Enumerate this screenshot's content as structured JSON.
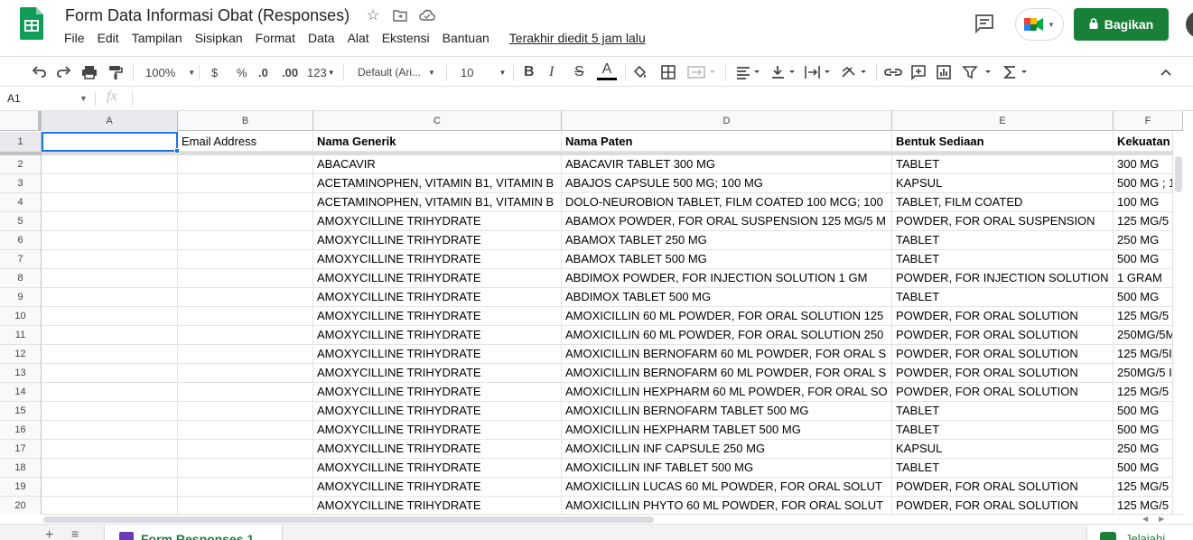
{
  "header": {
    "title": "Form Data Informasi Obat (Responses)",
    "menu": [
      "File",
      "Edit",
      "Tampilan",
      "Sisipkan",
      "Format",
      "Data",
      "Alat",
      "Ekstensi",
      "Bantuan"
    ],
    "last_edit": "Terakhir diedit 5 jam lalu",
    "share_label": "Bagikan"
  },
  "toolbar": {
    "zoom": "100%",
    "currency": "$",
    "percent": "%",
    "decrease_decimal": ".0",
    "increase_decimal": ".00",
    "more_formats": "123",
    "font": "Default (Ari...",
    "font_size": "10",
    "bold": "B",
    "italic": "I",
    "strike": "S",
    "text_color": "A"
  },
  "formula_bar": {
    "name_box": "A1",
    "fx": "fx"
  },
  "grid": {
    "columns": [
      "A",
      "B",
      "C",
      "D",
      "E",
      "F"
    ],
    "headers": [
      "",
      "Email Address",
      "Nama Generik",
      "Nama Paten",
      "Bentuk Sediaan",
      "Kekuatan"
    ],
    "row_numbers": [
      "1",
      "2",
      "3",
      "4",
      "5",
      "6",
      "7",
      "8",
      "9",
      "10",
      "11",
      "12",
      "13",
      "14",
      "15",
      "16",
      "17",
      "18",
      "19",
      "20"
    ],
    "rows": [
      [
        "",
        "",
        "ABACAVIR",
        "ABACAVIR TABLET 300 MG",
        "TABLET",
        "300 MG"
      ],
      [
        "",
        "",
        "ACETAMINOPHEN, VITAMIN B1, VITAMIN B",
        "ABAJOS CAPSULE 500 MG; 100 MG",
        "KAPSUL",
        "500 MG ; 1"
      ],
      [
        "",
        "",
        "ACETAMINOPHEN, VITAMIN B1, VITAMIN B",
        "DOLO-NEUROBION TABLET, FILM COATED 100 MCG; 100",
        "TABLET, FILM COATED",
        "100 MG"
      ],
      [
        "",
        "",
        "AMOXYCILLINE TRIHYDRATE",
        "ABAMOX POWDER, FOR ORAL SUSPENSION 125 MG/5 M",
        "POWDER, FOR ORAL SUSPENSION",
        "125 MG/5"
      ],
      [
        "",
        "",
        "AMOXYCILLINE TRIHYDRATE",
        "ABAMOX TABLET 250 MG",
        "TABLET",
        "250 MG"
      ],
      [
        "",
        "",
        "AMOXYCILLINE TRIHYDRATE",
        "ABAMOX TABLET 500 MG",
        "TABLET",
        "500 MG"
      ],
      [
        "",
        "",
        "AMOXYCILLINE TRIHYDRATE",
        "ABDIMOX POWDER, FOR INJECTION SOLUTION 1 GM",
        "POWDER, FOR INJECTION SOLUTION",
        "1 GRAM"
      ],
      [
        "",
        "",
        "AMOXYCILLINE TRIHYDRATE",
        "ABDIMOX TABLET 500 MG",
        "TABLET",
        "500 MG"
      ],
      [
        "",
        "",
        "AMOXYCILLINE TRIHYDRATE",
        "AMOXICILLIN 60 ML POWDER, FOR ORAL SOLUTION 125",
        "POWDER, FOR ORAL SOLUTION",
        "125 MG/5"
      ],
      [
        "",
        "",
        "AMOXYCILLINE TRIHYDRATE",
        "AMOXICILLIN 60 ML POWDER, FOR ORAL SOLUTION 250",
        "POWDER, FOR ORAL SOLUTION",
        "250MG/5M"
      ],
      [
        "",
        "",
        "AMOXYCILLINE TRIHYDRATE",
        "AMOXICILLIN BERNOFARM 60 ML POWDER, FOR ORAL S",
        "POWDER, FOR ORAL SOLUTION",
        "125 MG/5I"
      ],
      [
        "",
        "",
        "AMOXYCILLINE TRIHYDRATE",
        "AMOXICILLIN BERNOFARM 60 ML POWDER, FOR ORAL S",
        "POWDER, FOR ORAL SOLUTION",
        "250MG/5 I"
      ],
      [
        "",
        "",
        "AMOXYCILLINE TRIHYDRATE",
        "AMOXICILLIN HEXPHARM 60 ML POWDER, FOR ORAL SO",
        "POWDER, FOR ORAL SOLUTION",
        "125 MG/5"
      ],
      [
        "",
        "",
        "AMOXYCILLINE TRIHYDRATE",
        "AMOXICILLIN BERNOFARM TABLET 500 MG",
        "TABLET",
        "500 MG"
      ],
      [
        "",
        "",
        "AMOXYCILLINE TRIHYDRATE",
        "AMOXICILLIN  HEXPHARM TABLET 500 MG",
        "TABLET",
        "500 MG"
      ],
      [
        "",
        "",
        "AMOXYCILLINE TRIHYDRATE",
        "AMOXICILLIN INF CAPSULE 250 MG",
        "KAPSUL",
        "250 MG"
      ],
      [
        "",
        "",
        "AMOXYCILLINE TRIHYDRATE",
        "AMOXICILLIN  INF TABLET 500 MG",
        "TABLET",
        "500 MG"
      ],
      [
        "",
        "",
        "AMOXYCILLINE TRIHYDRATE",
        "AMOXICILLIN LUCAS 60 ML POWDER, FOR ORAL SOLUT",
        "POWDER, FOR  ORAL SOLUTION",
        "125 MG/5"
      ],
      [
        "",
        "",
        "AMOXYCILLINE TRIHYDRATE",
        "AMOXICILLIN PHYTO 60 ML POWDER, FOR ORAL SOLUT",
        "POWDER, FOR ORAL SOLUTION",
        "125 MG/5"
      ]
    ]
  },
  "sheets": {
    "add": "+",
    "list": "≡",
    "active_tab": "Form Responses 1",
    "explore": "Jelajahi"
  },
  "colors": {
    "accent": "#188038",
    "selection": "#1a73e8"
  }
}
